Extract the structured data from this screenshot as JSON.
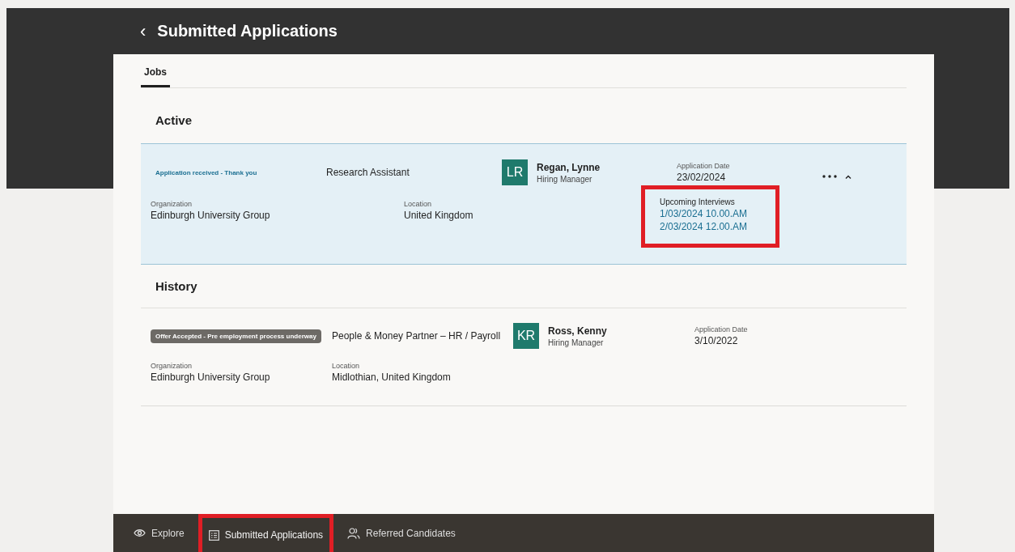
{
  "header": {
    "back": "‹",
    "title": "Submitted Applications"
  },
  "tabs": [
    {
      "label": "Jobs",
      "selected": true
    }
  ],
  "sections": [
    {
      "title": "Active",
      "rows": [
        {
          "status": {
            "kind": "text",
            "text": "Application received - Thank you"
          },
          "job": "Research Assistant",
          "initials": "LR",
          "manager": "Regan, Lynne",
          "role": "Hiring Manager",
          "date_label": "Application Date",
          "date": "23/02/2024",
          "expanded": true,
          "organization_label": "Organization",
          "organization": "Edinburgh University Group",
          "location_label": "Location",
          "location": "United Kingdom",
          "interviews": {
            "label": "Upcoming Interviews",
            "highlighted": true,
            "items": [
              "1/03/2024 10.00.AM",
              "2/03/2024 12.00.AM"
            ]
          }
        }
      ]
    },
    {
      "title": "History",
      "rows": [
        {
          "status": {
            "kind": "badge",
            "text": "Offer Accepted - Pre employment process underway"
          },
          "job": "People & Money Partner – HR / Payroll",
          "initials": "KR",
          "manager": "Ross, Kenny",
          "role": "Hiring Manager",
          "date_label": "Application Date",
          "date": "3/10/2022",
          "expanded": false,
          "organization_label": "Organization",
          "organization": "Edinburgh University Group",
          "location_label": "Location",
          "location": "Midlothian, United Kingdom"
        }
      ]
    }
  ],
  "nav": [
    {
      "label": "Explore",
      "kind": "eye",
      "selected": false,
      "highlighted": false
    },
    {
      "label": "Submitted Applications",
      "kind": "list",
      "selected": true,
      "highlighted": true
    },
    {
      "label": "Referred Candidates",
      "kind": "people",
      "selected": false,
      "highlighted": false
    }
  ]
}
